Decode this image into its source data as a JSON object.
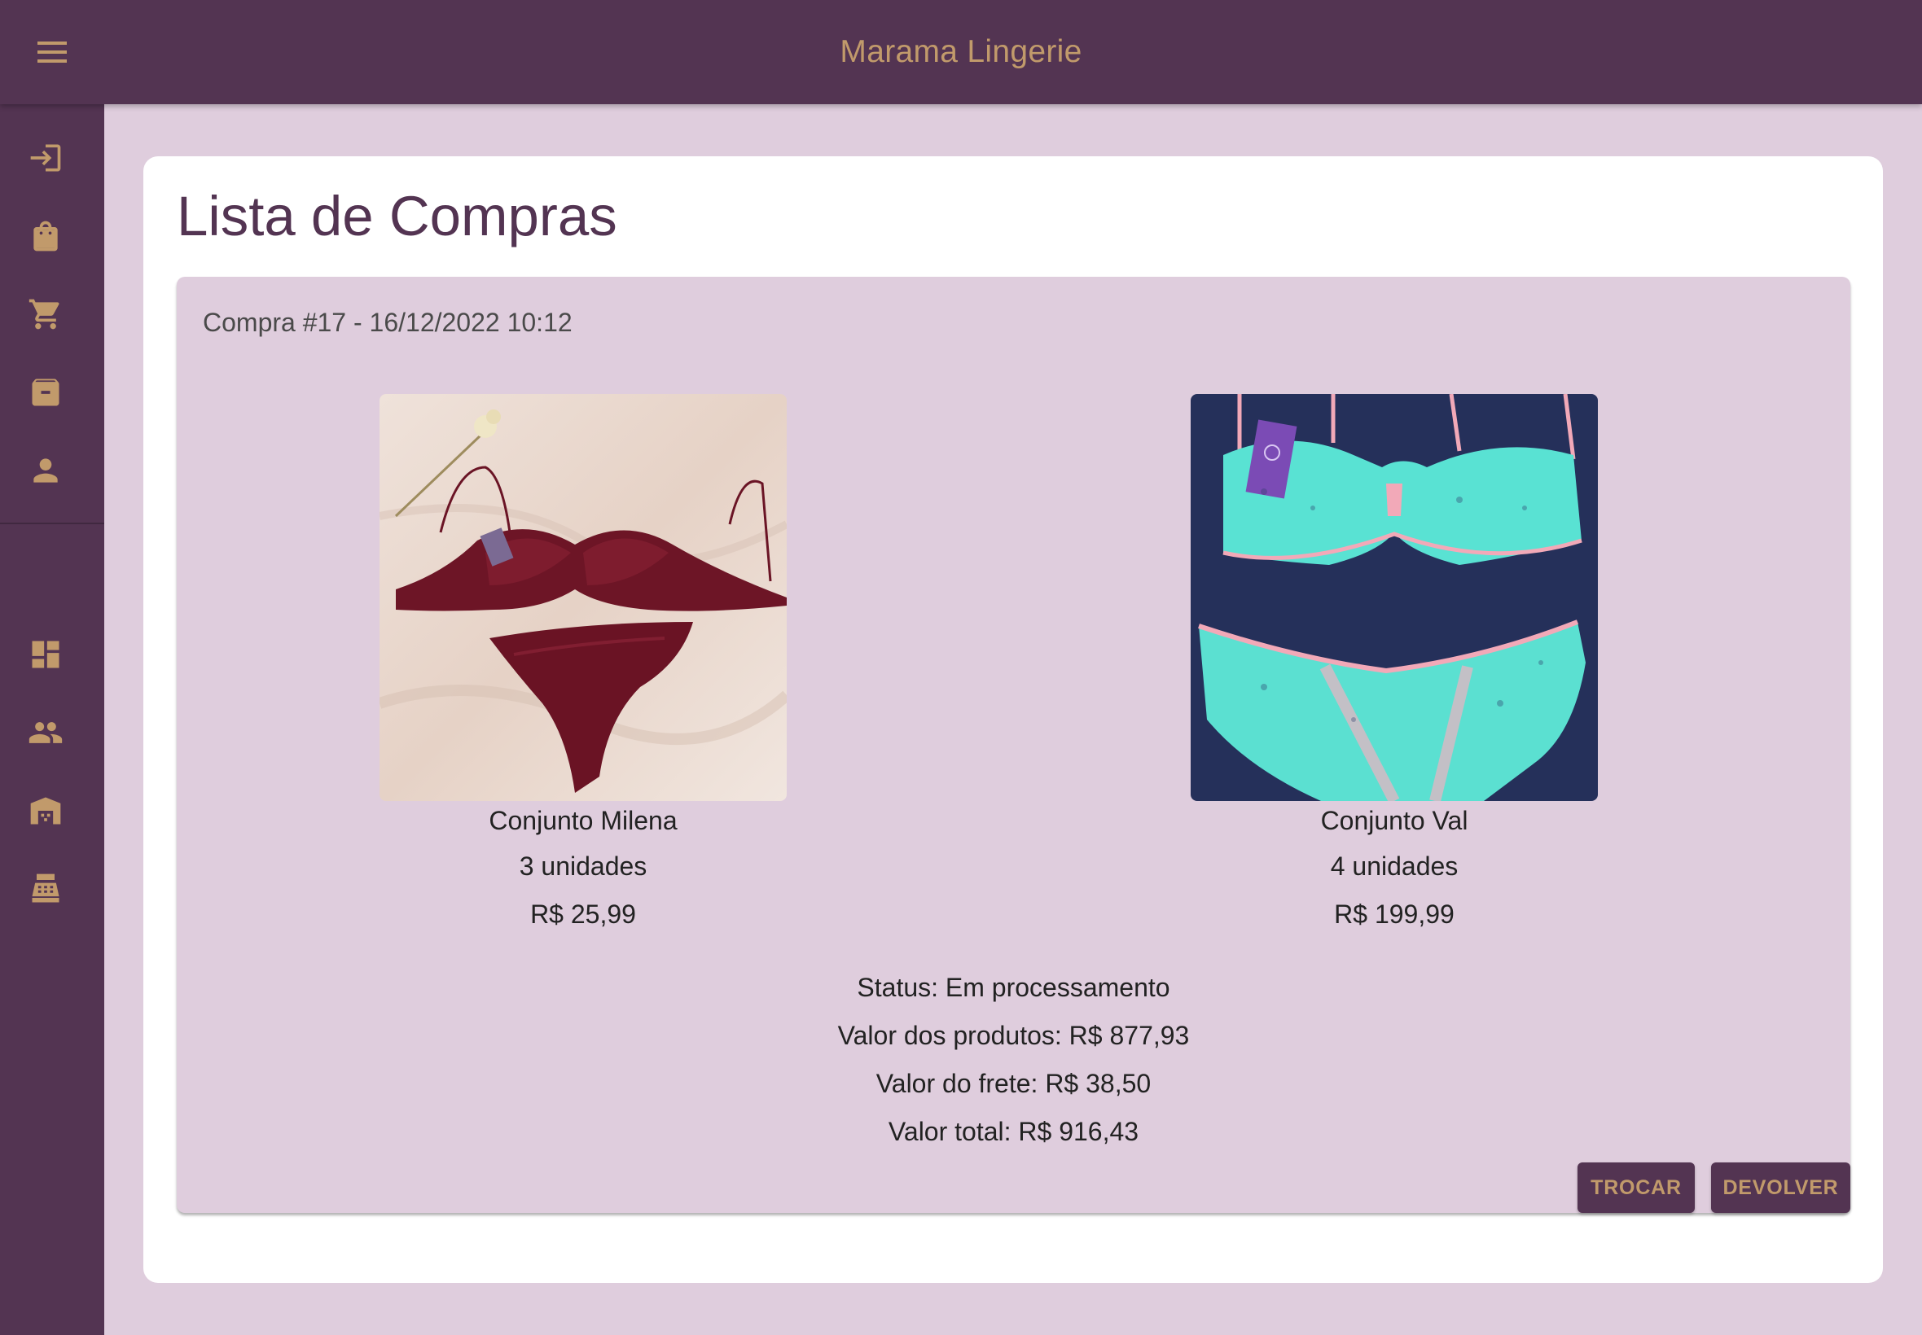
{
  "app": {
    "title": "Marama Lingerie",
    "menu_icon": "hamburger-menu-icon"
  },
  "colors": {
    "primary": "#533452",
    "accent": "#c19a6b",
    "background": "#dfcddd",
    "surface": "#ffffff"
  },
  "sidebar": {
    "items": [
      {
        "icon": "login-icon"
      },
      {
        "icon": "shopping-bag-icon"
      },
      {
        "icon": "cart-icon"
      },
      {
        "icon": "archive-icon"
      },
      {
        "icon": "person-icon"
      },
      {
        "icon": "dashboard-icon"
      },
      {
        "icon": "people-icon"
      },
      {
        "icon": "warehouse-icon"
      },
      {
        "icon": "cash-register-icon"
      }
    ]
  },
  "page": {
    "title": "Lista de Compras"
  },
  "order": {
    "header": "Compra #17 - 16/12/2022 10:12",
    "products": [
      {
        "name": "Conjunto Milena",
        "quantity": "3 unidades",
        "price": "R$ 25,99"
      },
      {
        "name": "Conjunto Val",
        "quantity": "4 unidades",
        "price": "R$ 199,99"
      }
    ],
    "status": "Status: Em processamento",
    "products_value": "Valor dos produtos: R$ 877,93",
    "shipping_value": "Valor do frete: R$ 38,50",
    "total_value": "Valor total: R$ 916,43",
    "actions": {
      "exchange_label": "TROCAR",
      "return_label": "DEVOLVER"
    }
  }
}
